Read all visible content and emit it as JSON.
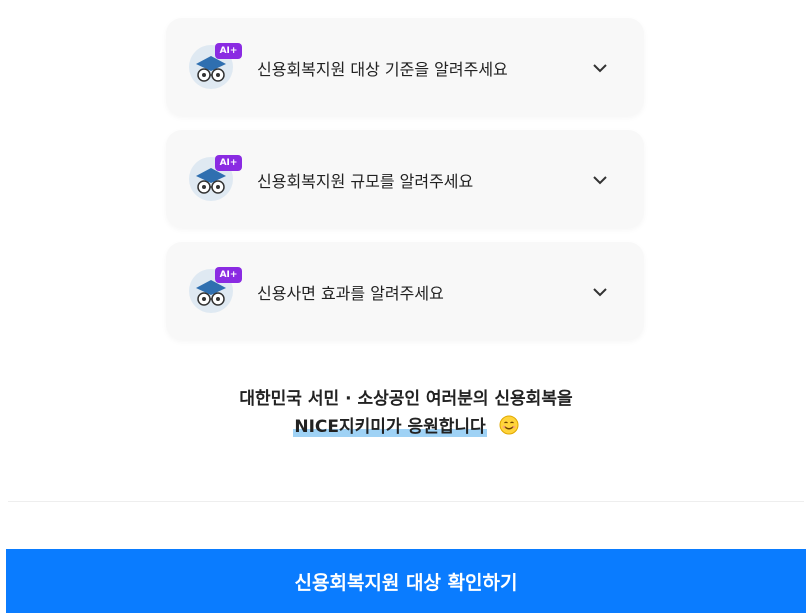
{
  "faq": [
    {
      "label": "신용회복지원 대상 기준을 알려주세요",
      "badge": "AI+",
      "icon": "chevron-down-icon"
    },
    {
      "label": "신용회복지원 규모를 알려주세요",
      "badge": "AI+",
      "icon": "chevron-down-icon"
    },
    {
      "label": "신용사면 효과를 알려주세요",
      "badge": "AI+",
      "icon": "chevron-down-icon"
    }
  ],
  "cheer": {
    "line1": "대한민국 서민 · 소상공인 여러분의 신용회복을",
    "line2": "NICE지키미가 응원합니다",
    "emoji_icon": "smile-emoji-icon",
    "highlight_color": "#9fd2f5"
  },
  "cta": {
    "label": "신용회복지원 대상 확인하기",
    "color": "#0a7cff"
  },
  "colors": {
    "card_bg": "#f8f8f8",
    "ai_badge": "#8a2be2"
  }
}
